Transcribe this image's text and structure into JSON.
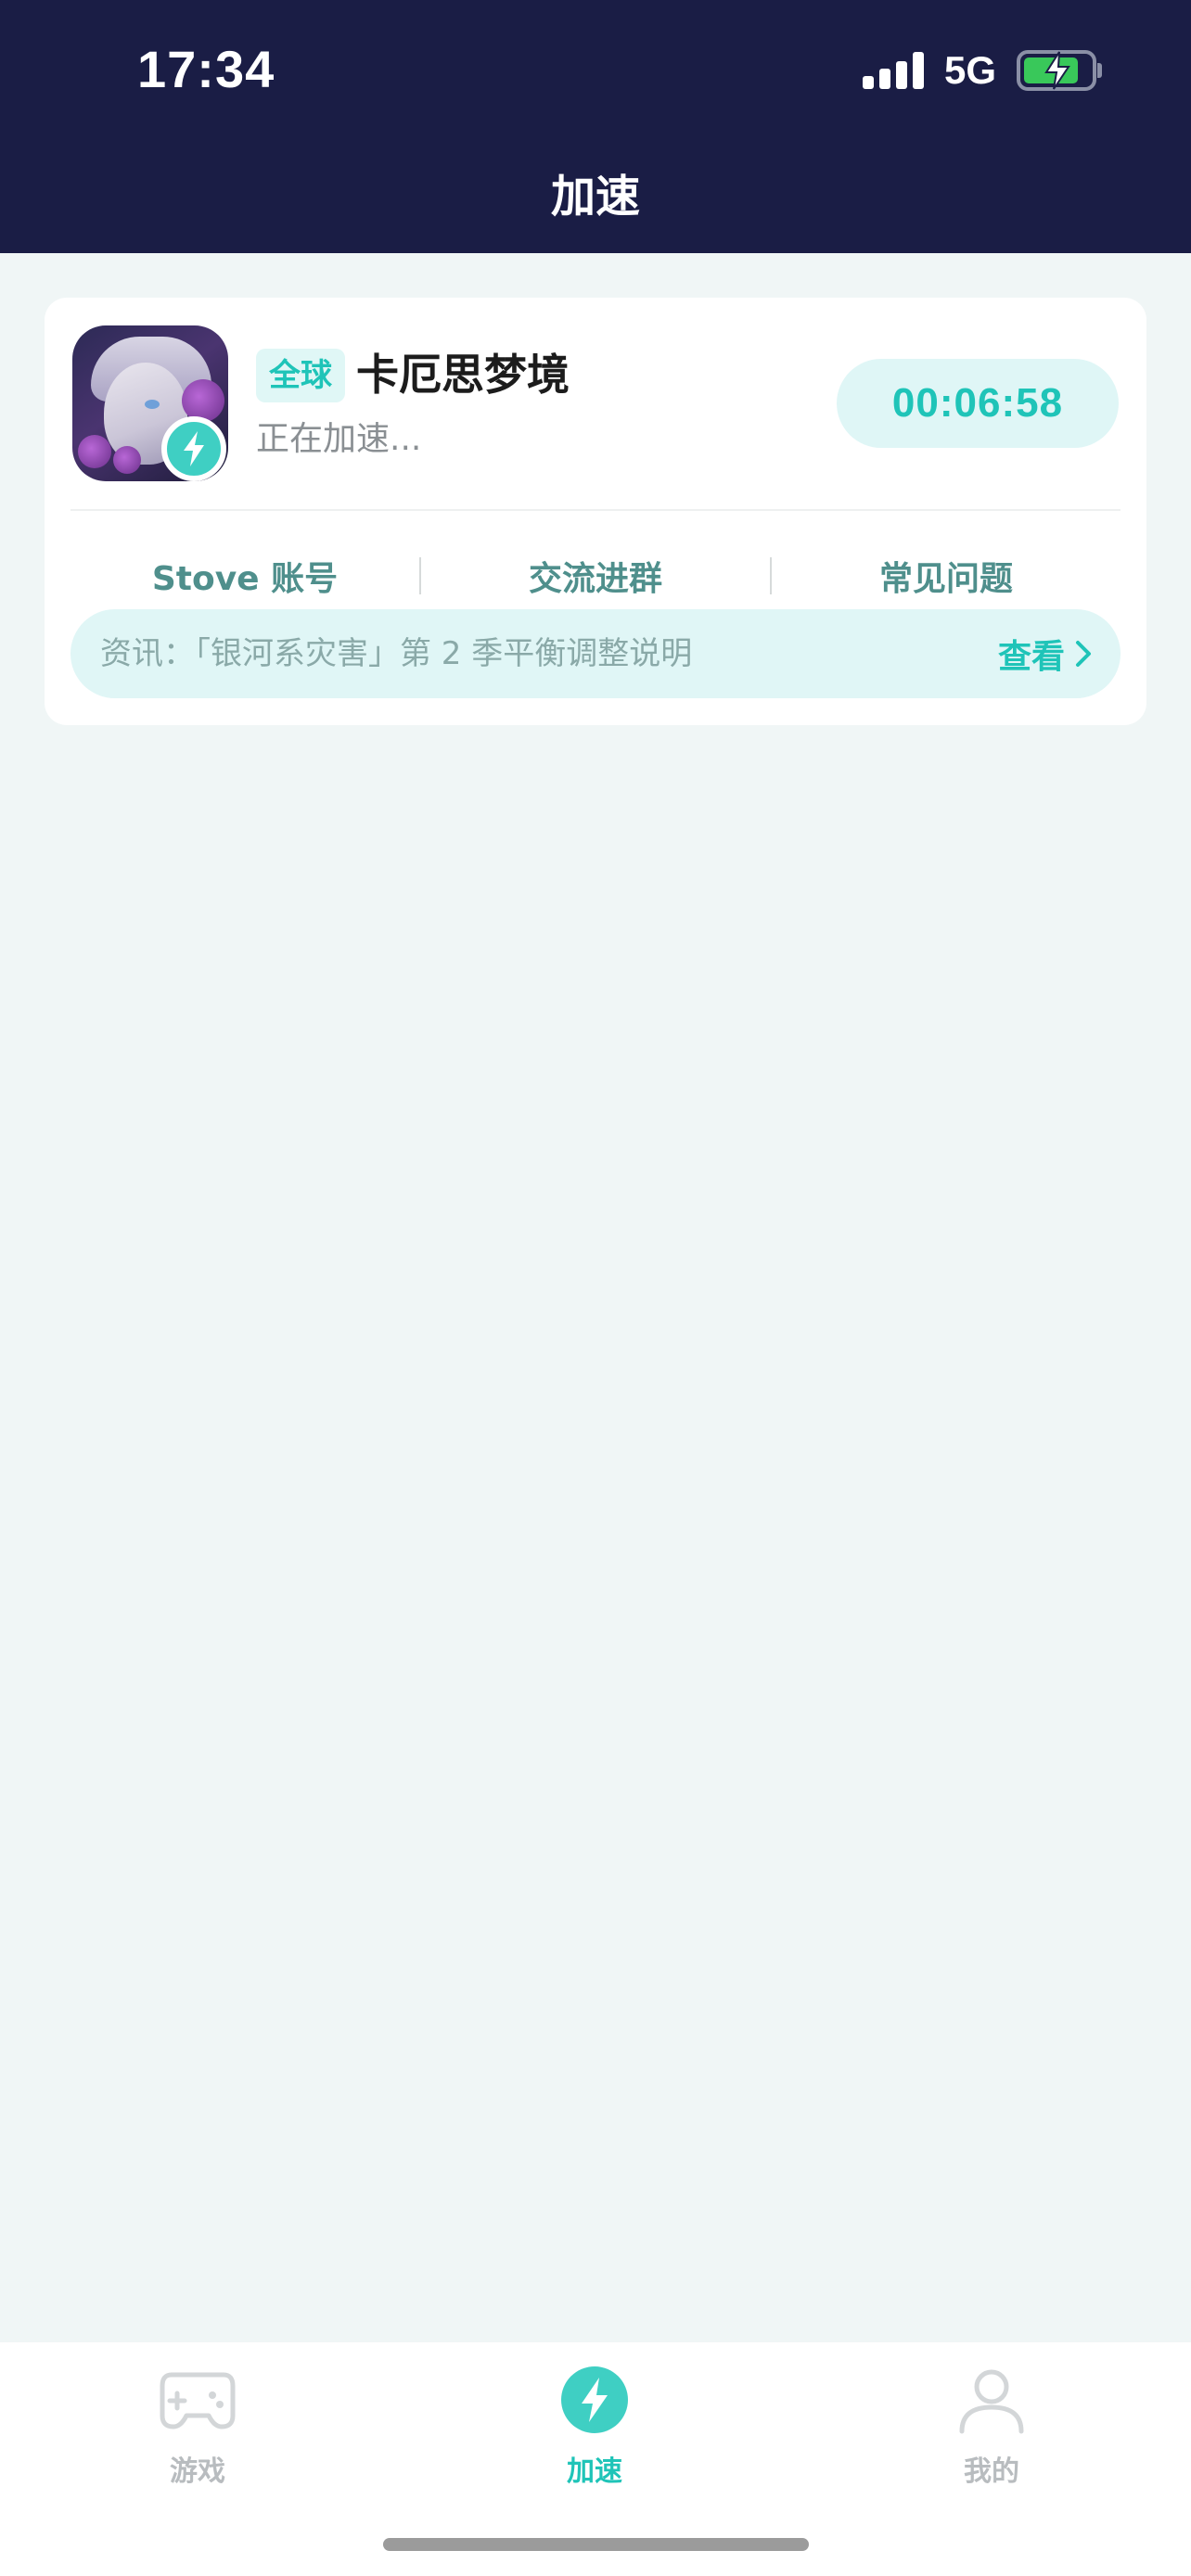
{
  "status_bar": {
    "time": "17:34",
    "network": "5G",
    "battery_charging": true
  },
  "header": {
    "title": "加速"
  },
  "game_card": {
    "region_tag": "全球",
    "name": "卡厄思梦境",
    "status": "正在加速...",
    "timer": "00:06:58",
    "links": [
      "Stove 账号",
      "交流进群",
      "常见问题"
    ],
    "news": {
      "text": "资讯：「银河系灾害」第 2 季平衡调整说明",
      "action": "查看"
    }
  },
  "tab_bar": {
    "items": [
      {
        "label": "游戏",
        "icon": "gamepad-icon",
        "active": false
      },
      {
        "label": "加速",
        "icon": "lightning-icon",
        "active": true
      },
      {
        "label": "我的",
        "icon": "person-icon",
        "active": false
      }
    ]
  },
  "colors": {
    "header_bg": "#1a1d45",
    "accent": "#1fc4b8",
    "page_bg": "#f0f6f6",
    "inactive": "#b8bcbf"
  }
}
